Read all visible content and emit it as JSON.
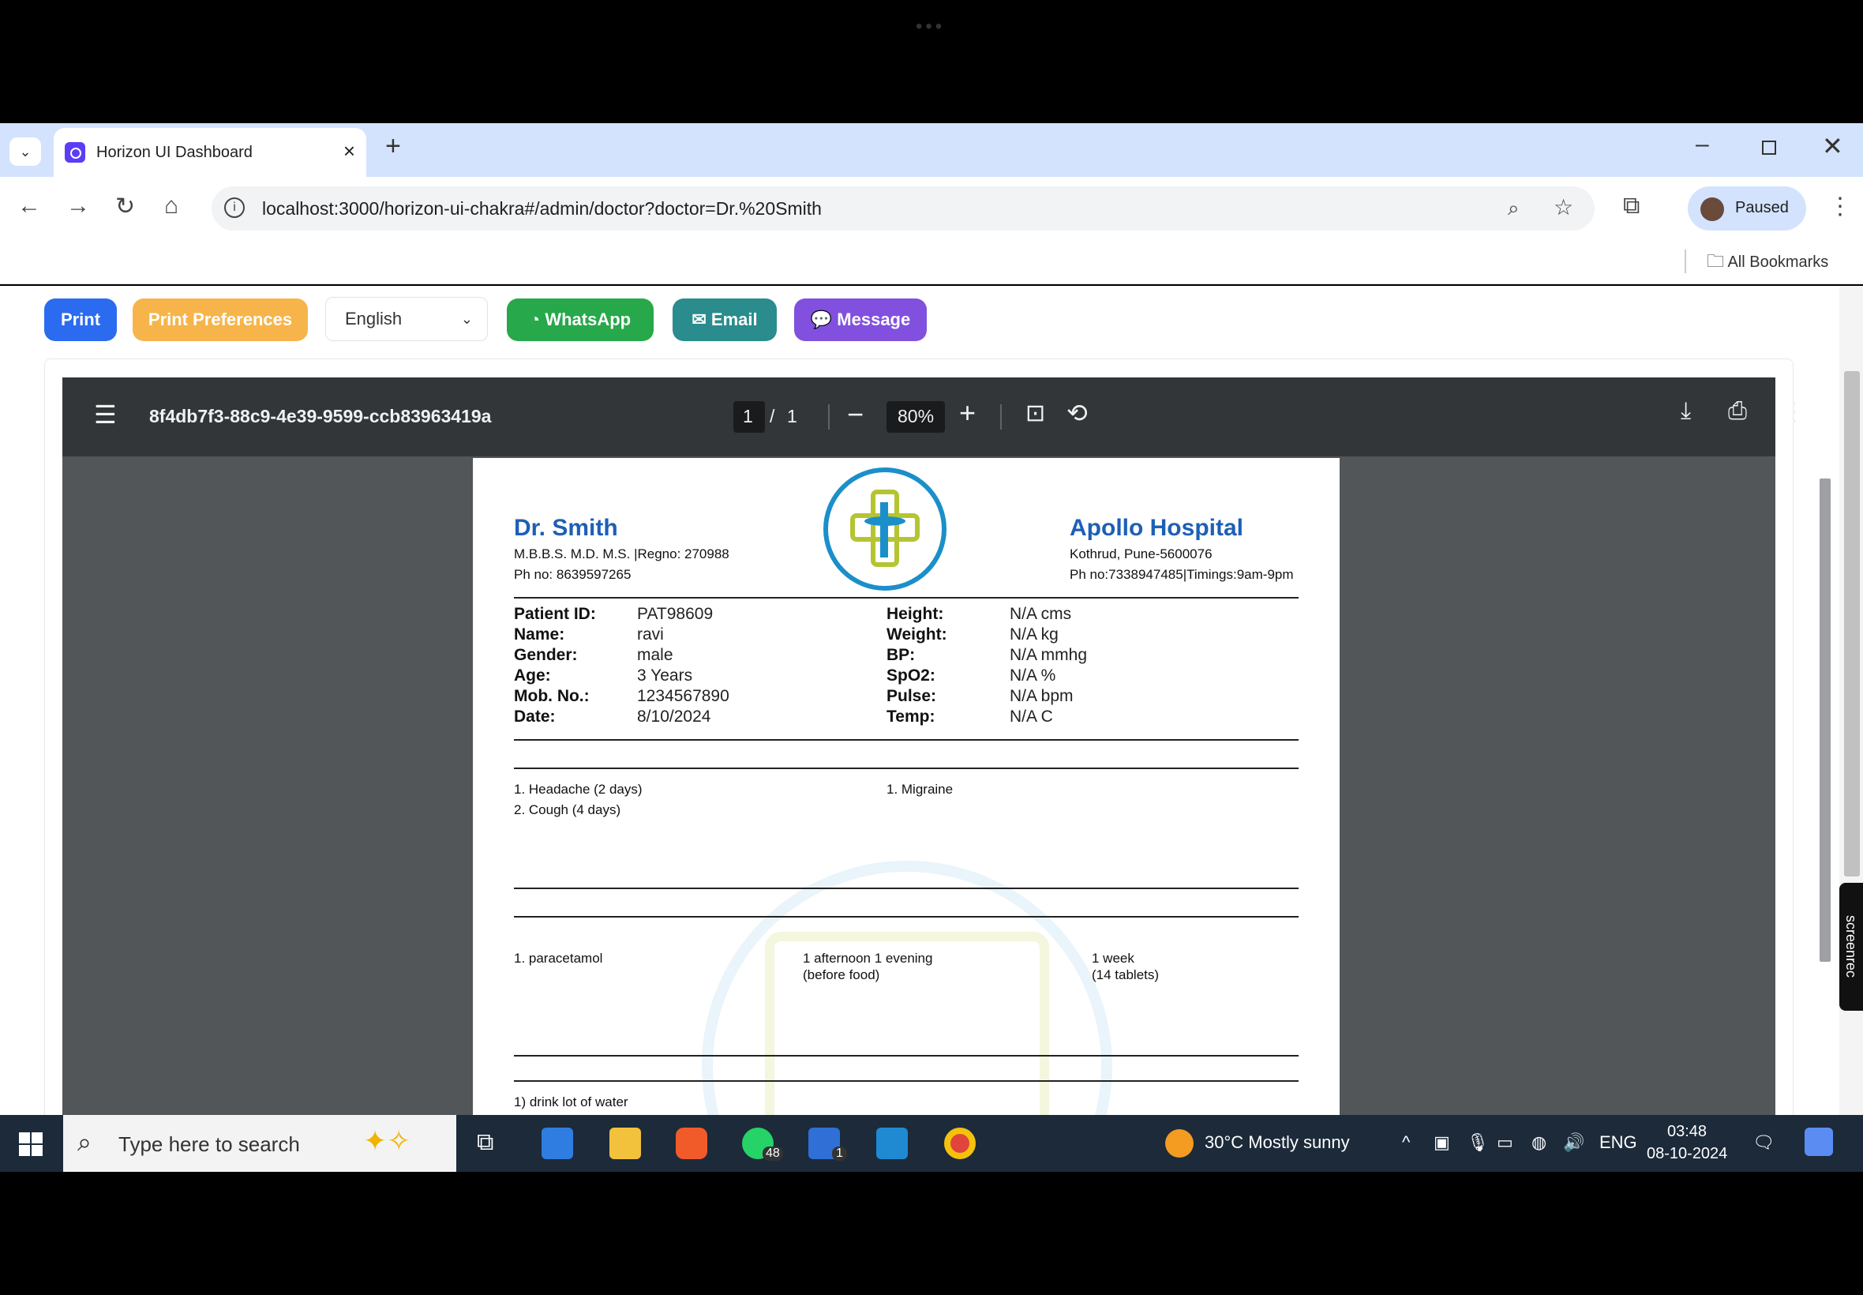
{
  "browser": {
    "tab_title": "Horizon UI Dashboard",
    "url": "localhost:3000/horizon-ui-chakra#/admin/doctor?doctor=Dr.%20Smith",
    "profile_label": "Paused",
    "bookmarks_label": "All Bookmarks"
  },
  "actions": {
    "print": "Print",
    "print_preferences": "Print Preferences",
    "language": "English",
    "whatsapp": "WhatsApp",
    "email": "Email",
    "message": "Message"
  },
  "colors": {
    "print": "#2b6bf0",
    "print_preferences": "#f6b44a",
    "whatsapp": "#27a84a",
    "email": "#2a8c8c",
    "message": "#8250df",
    "doctor_blue": "#1d5fb5"
  },
  "pdf_viewer": {
    "filename": "8f4db7f3-88c9-4e39-9599-ccb83963419a",
    "page_current": "1",
    "page_sep": "/",
    "page_total": "1",
    "zoom": "80%"
  },
  "prescription": {
    "doctor_name": "Dr. Smith",
    "doctor_quals": "M.B.B.S. M.D. M.S. |Regno: 270988",
    "doctor_phone": "Ph no: 8639597265",
    "hospital_name": "Apollo Hospital",
    "hospital_address": "Kothrud, Pune-5600076",
    "hospital_phone": "Ph no:7338947485|Timings:9am-9pm",
    "patient": {
      "id_label": "Patient ID:",
      "id": "PAT98609",
      "name_label": "Name:",
      "name": "ravi",
      "gender_label": "Gender:",
      "gender": "male",
      "age_label": "Age:",
      "age": "3 Years",
      "mob_label": "Mob. No.:",
      "mob": "1234567890",
      "date_label": "Date:",
      "date": "8/10/2024"
    },
    "vitals": {
      "height_label": "Height:",
      "height": "N/A cms",
      "weight_label": "Weight:",
      "weight": "N/A kg",
      "bp_label": "BP:",
      "bp": "N/A mmhg",
      "spo2_label": "SpO2:",
      "spo2": "N/A %",
      "pulse_label": "Pulse:",
      "pulse": "N/A bpm",
      "temp_label": "Temp:",
      "temp": "N/A C"
    },
    "symptoms": [
      "1. Headache (2 days)",
      "2. Cough (4 days)"
    ],
    "diagnosis": [
      "1. Migraine"
    ],
    "medicine": {
      "name": "1. paracetamol",
      "timing_line1": "1 afternoon 1 evening",
      "timing_line2": "(before food)",
      "duration_line1": "1 week",
      "duration_line2": "(14 tablets)"
    },
    "advice": "1) drink lot of water"
  },
  "taskbar": {
    "search_placeholder": "Type here to search",
    "whatsapp_badge": "48",
    "todo_badge": "1",
    "weather": "30°C  Mostly sunny",
    "lang": "ENG",
    "time": "03:48",
    "date": "08-10-2024"
  },
  "screenrec_label": "screenrec"
}
